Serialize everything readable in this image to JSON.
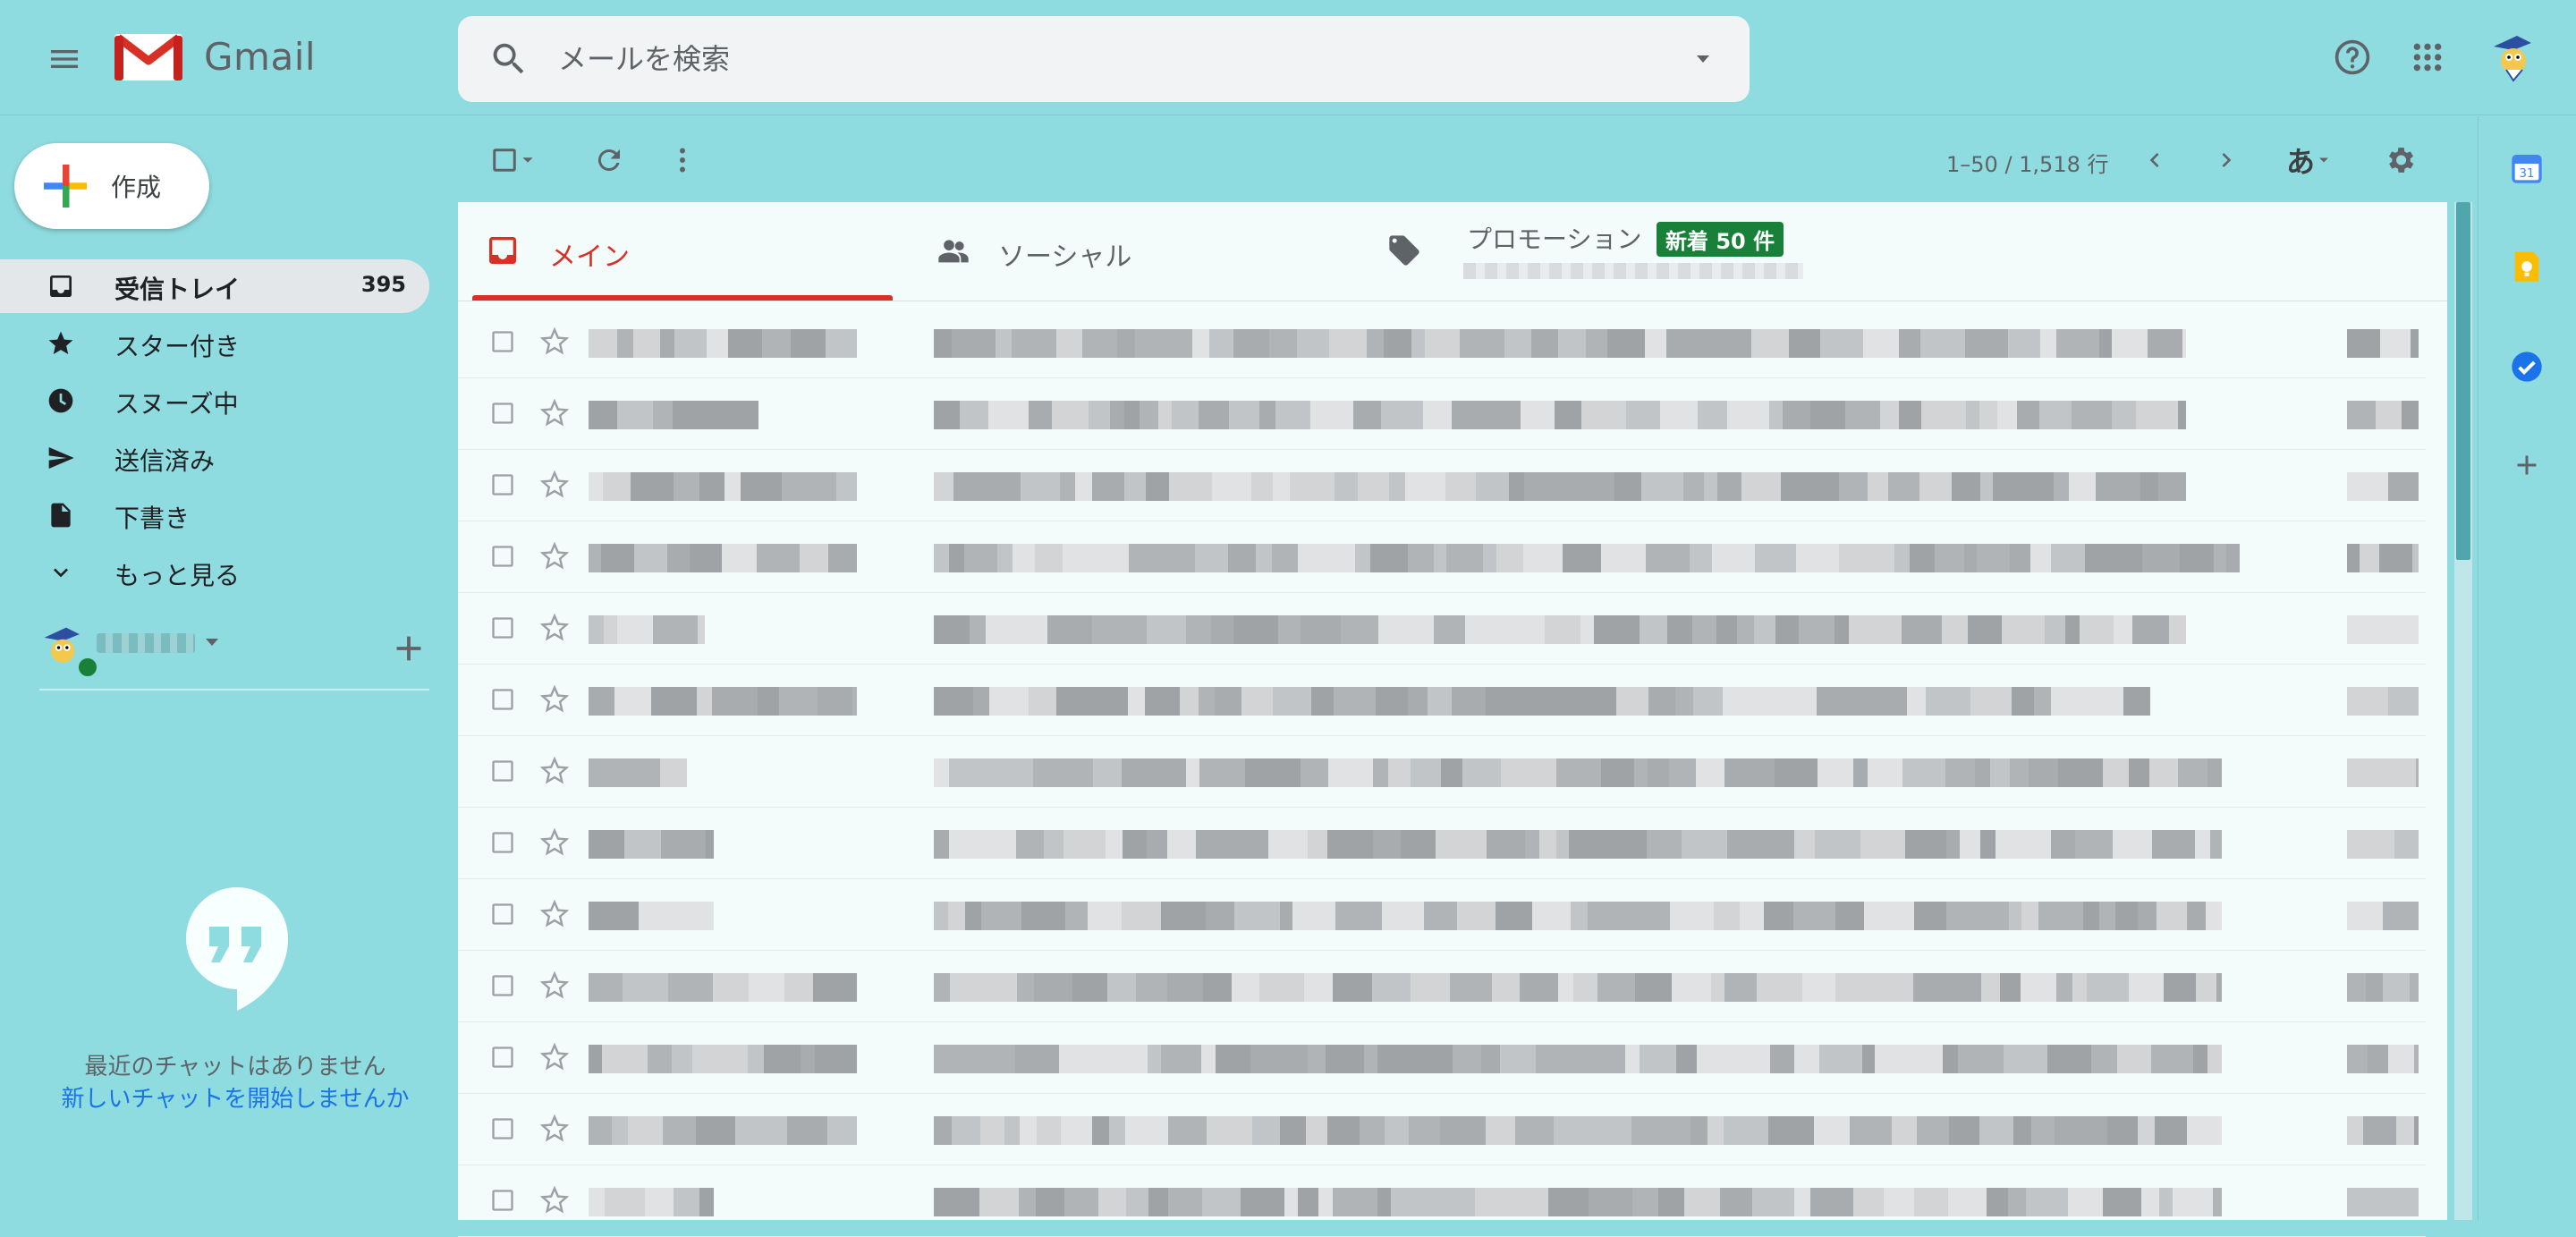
{
  "header": {
    "app_name": "Gmail",
    "search_placeholder": "メールを検索"
  },
  "sidebar": {
    "compose_label": "作成",
    "items": [
      {
        "label": "受信トレイ",
        "count": "395",
        "icon": "inbox-icon",
        "active": true
      },
      {
        "label": "スター付き",
        "icon": "star-icon"
      },
      {
        "label": "スヌーズ中",
        "icon": "clock-icon"
      },
      {
        "label": "送信済み",
        "icon": "send-icon"
      },
      {
        "label": "下書き",
        "icon": "draft-icon"
      },
      {
        "label": "もっと見る",
        "icon": "chevron-down-icon"
      }
    ],
    "hangouts": {
      "empty_text": "最近のチャットはありません",
      "start_chat_link": "新しいチャットを開始しませんか"
    }
  },
  "toolbar": {
    "pagination": "1–50 / 1,518 行",
    "input_tool_label": "あ"
  },
  "tabs": [
    {
      "label": "メイン",
      "icon": "inbox-tab-icon",
      "active": true
    },
    {
      "label": "ソーシャル",
      "icon": "people-icon"
    },
    {
      "label": "プロモーション",
      "icon": "tag-icon",
      "badge": "新着 50 件"
    }
  ],
  "colors": {
    "background": "#8fdce0",
    "accent_red": "#d93025",
    "badge_green": "#188038",
    "link_blue": "#1a73e8"
  }
}
